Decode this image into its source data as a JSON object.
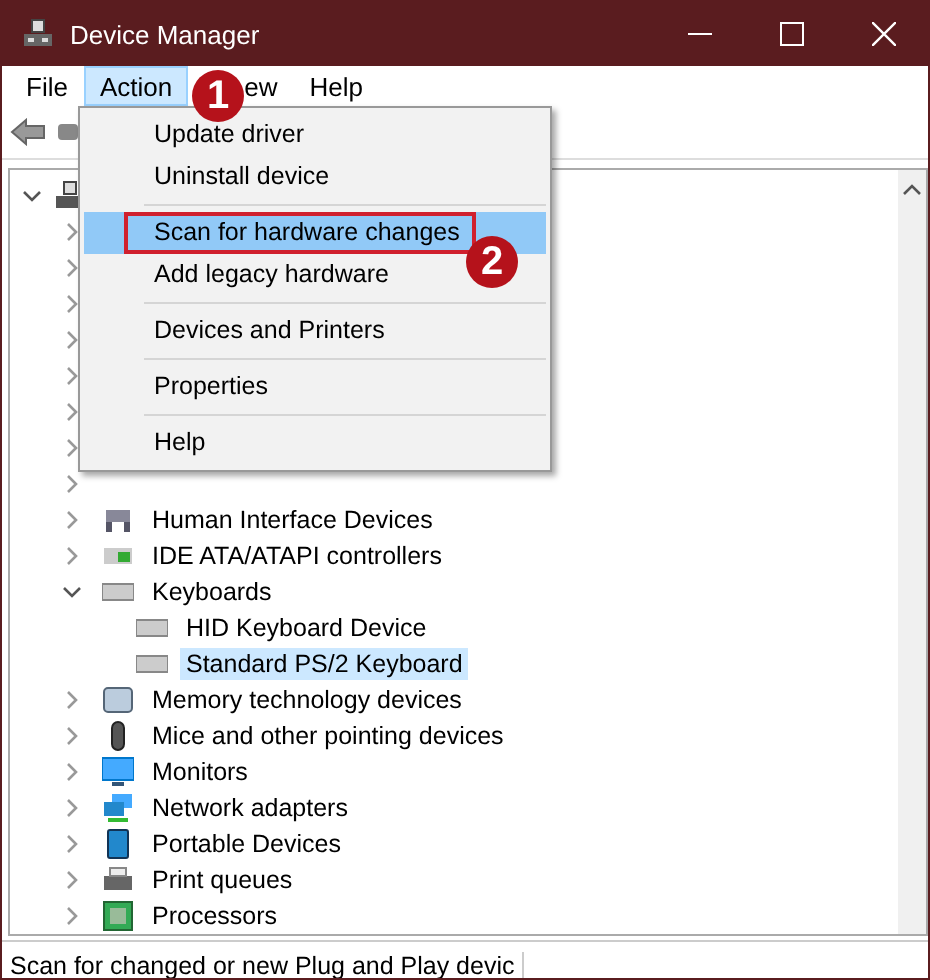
{
  "window": {
    "title": "Device Manager"
  },
  "menu_bar": [
    {
      "label": "File",
      "selected": false
    },
    {
      "label": "Action",
      "selected": true
    },
    {
      "label": "ew",
      "selected": false
    },
    {
      "label": "Help",
      "selected": false
    }
  ],
  "action_menu": [
    {
      "label": "Update driver",
      "selected": false,
      "separator_after": false,
      "callout": false
    },
    {
      "label": "Uninstall device",
      "selected": false,
      "separator_after": true,
      "callout": false
    },
    {
      "label": "Scan for hardware changes",
      "selected": true,
      "separator_after": false,
      "callout": true
    },
    {
      "label": "Add legacy hardware",
      "selected": false,
      "separator_after": true,
      "callout": false
    },
    {
      "label": "Devices and Printers",
      "selected": false,
      "separator_after": true,
      "callout": false
    },
    {
      "label": "Properties",
      "selected": false,
      "separator_after": true,
      "callout": false
    },
    {
      "label": "Help",
      "selected": false,
      "separator_after": false,
      "callout": false
    }
  ],
  "annotations": [
    {
      "label": "1"
    },
    {
      "label": "2"
    }
  ],
  "tree": {
    "expanded": true,
    "children": [
      {
        "label": "Human Interface Devices",
        "expanded": false,
        "selected": false
      },
      {
        "label": "IDE ATA/ATAPI controllers",
        "expanded": false,
        "selected": false
      },
      {
        "label": "Keyboards",
        "expanded": true,
        "selected": false,
        "children": [
          {
            "label": "HID Keyboard Device",
            "selected": false
          },
          {
            "label": "Standard PS/2 Keyboard",
            "selected": true
          }
        ]
      },
      {
        "label": "Memory technology devices",
        "expanded": false,
        "selected": false
      },
      {
        "label": "Mice and other pointing devices",
        "expanded": false,
        "selected": false
      },
      {
        "label": "Monitors",
        "expanded": false,
        "selected": false
      },
      {
        "label": "Network adapters",
        "expanded": false,
        "selected": false
      },
      {
        "label": "Portable Devices",
        "expanded": false,
        "selected": false
      },
      {
        "label": "Print queues",
        "expanded": false,
        "selected": false
      },
      {
        "label": "Processors",
        "expanded": false,
        "selected": false
      }
    ]
  },
  "status_bar": {
    "text": "Scan for changed or new Plug and Play devic"
  }
}
